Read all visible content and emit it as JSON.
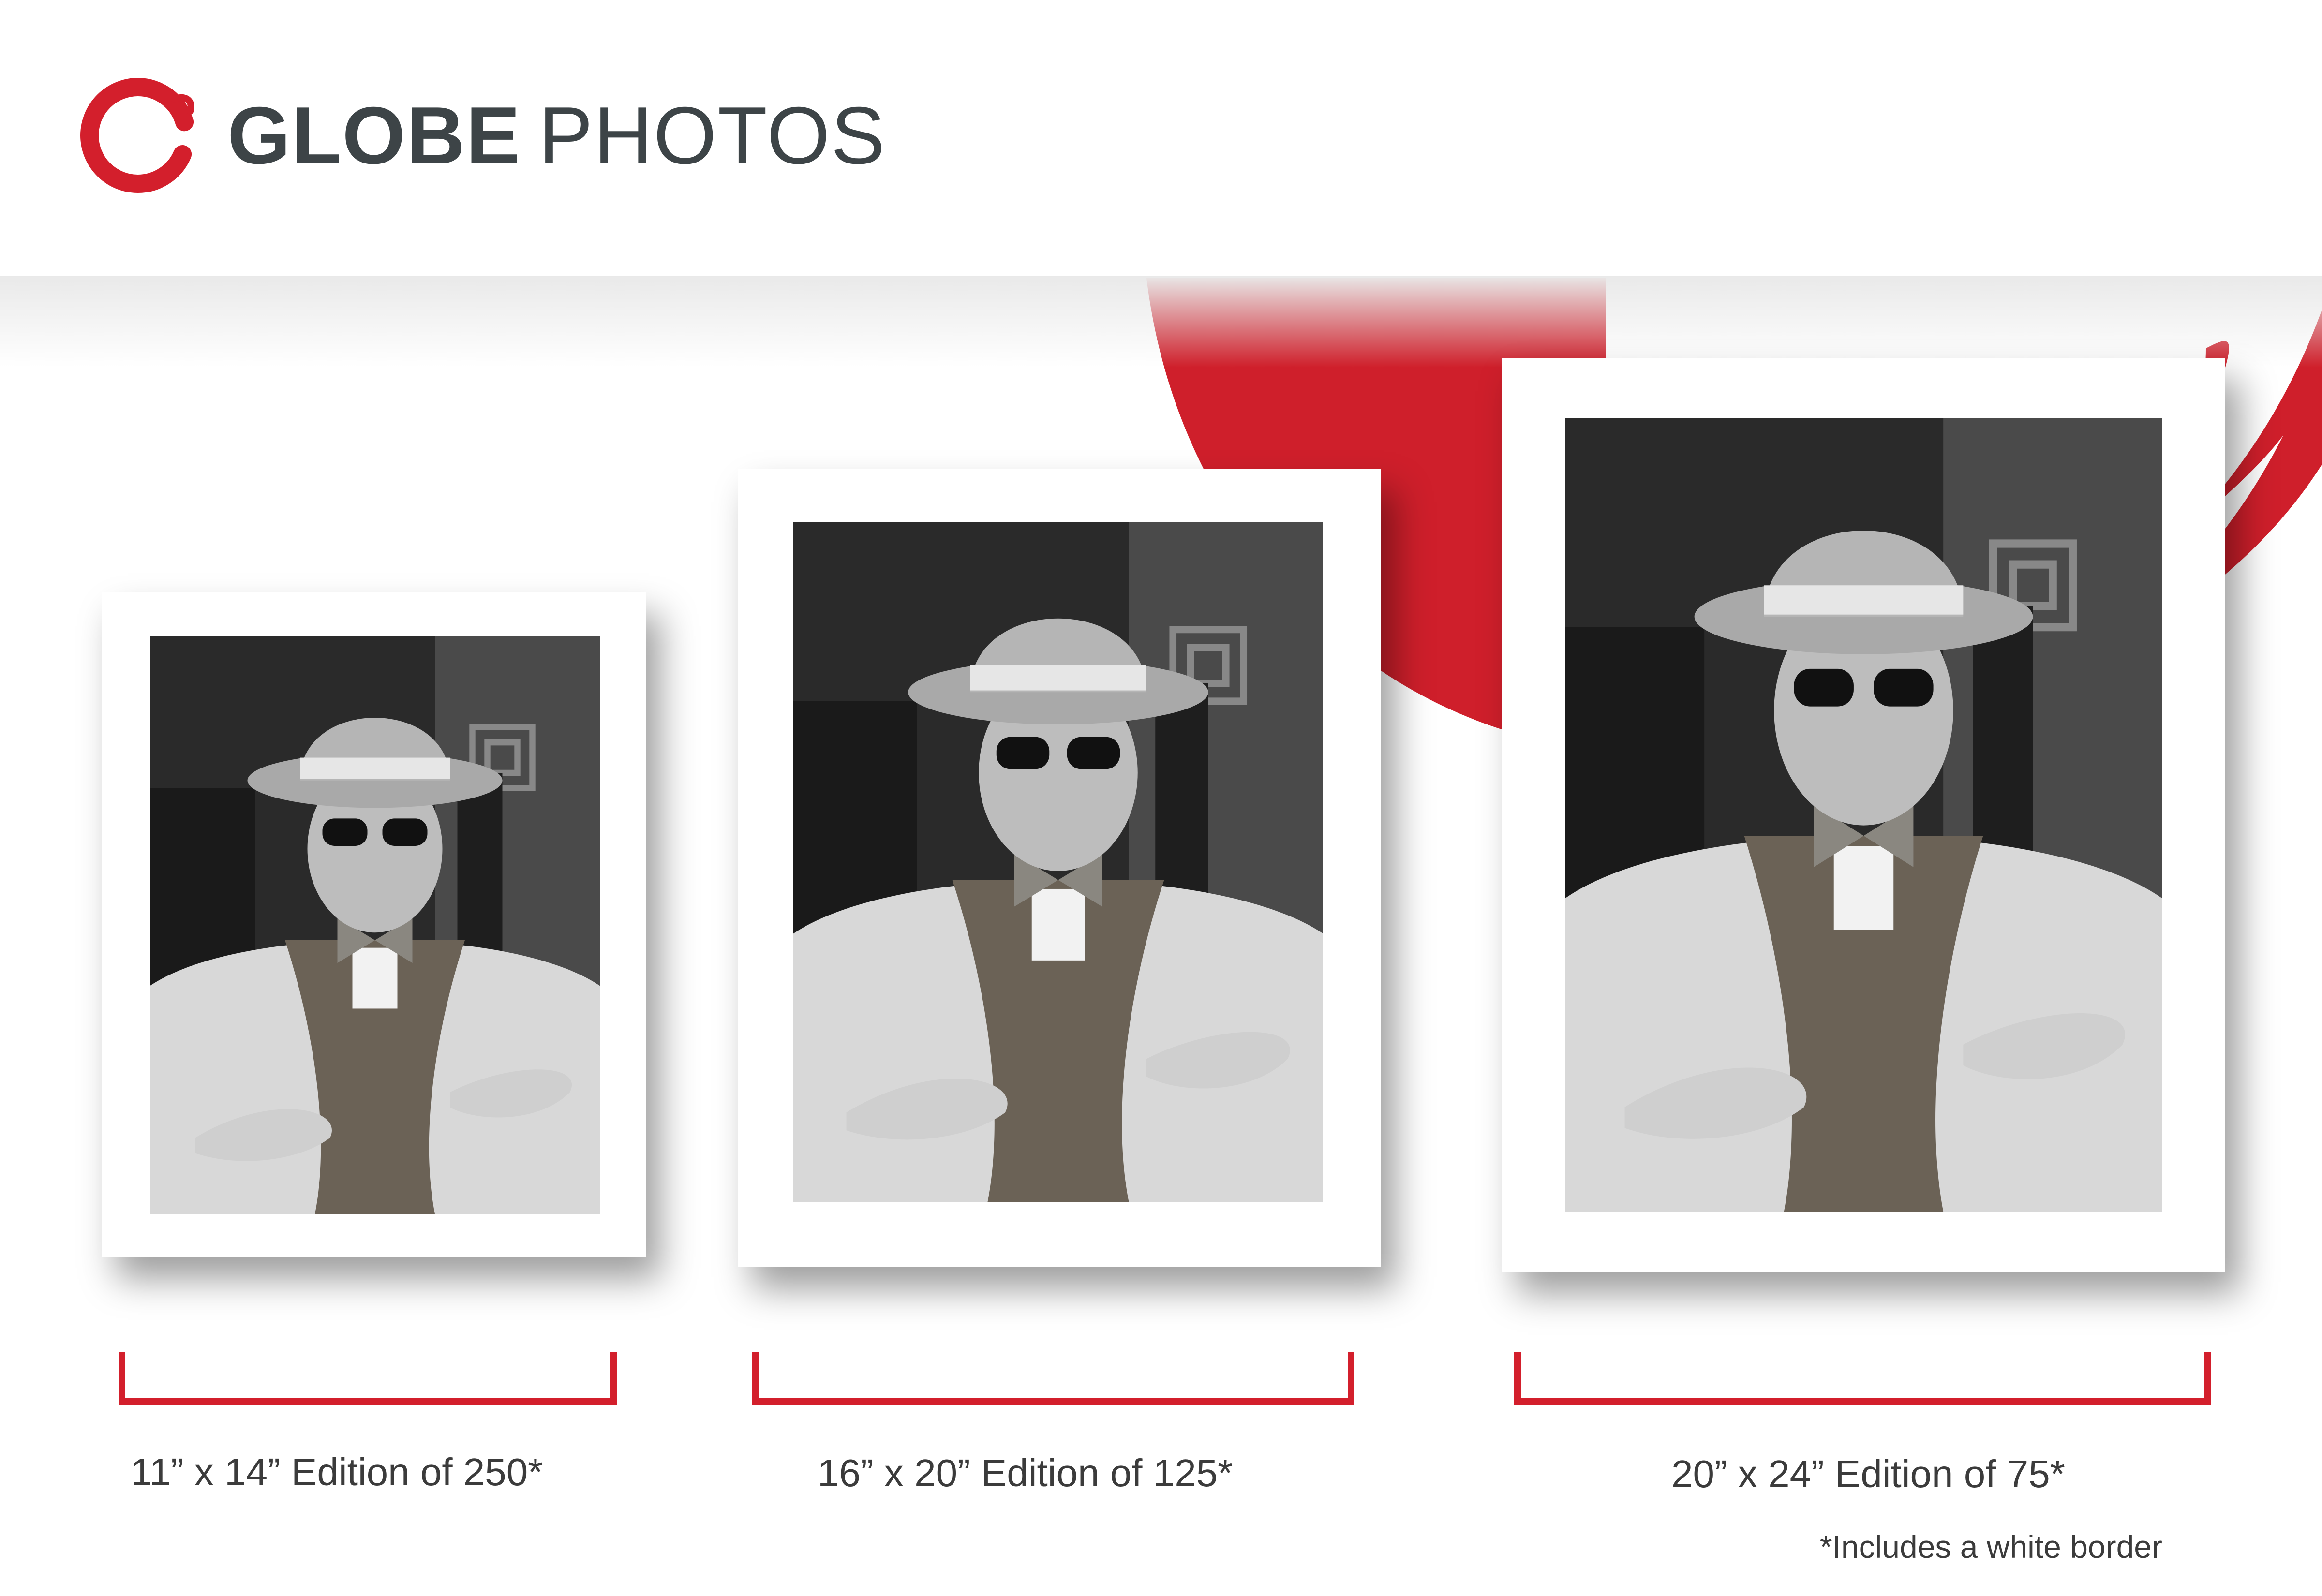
{
  "brand": {
    "name_bold": "GLOBE",
    "name_light": "PHOTOS",
    "accent_color": "#d31f2c",
    "text_color": "#3d4447"
  },
  "editions": [
    {
      "size": "11” x 14”",
      "label": "11” x 14” Edition of 250*"
    },
    {
      "size": "16” x 20”",
      "label": "16” x 20” Edition of 125*"
    },
    {
      "size": "20” x 24”",
      "label": "20” x 24” Edition of 75*"
    }
  ],
  "footnote": "*Includes a white border",
  "photo_description_icon": "portrait-photo"
}
